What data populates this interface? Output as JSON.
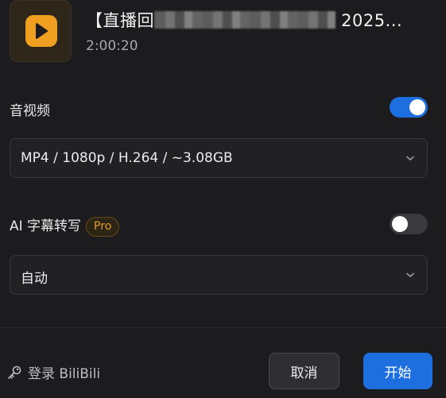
{
  "video": {
    "title_prefix": "【直播回",
    "title_suffix": " 2025...",
    "duration": "2:00:20"
  },
  "audio_video": {
    "label": "音视频",
    "enabled": true,
    "format_value": "MP4 / 1080p / H.264 / ~3.08GB"
  },
  "ai_subtitle": {
    "label": "AI 字幕转写",
    "badge": "Pro",
    "enabled": false,
    "language_value": "自动"
  },
  "footer": {
    "login_label": "登录 BiliBili",
    "cancel_label": "取消",
    "start_label": "开始"
  },
  "colors": {
    "accent": "#1d6fe0",
    "pro": "#e39a25",
    "logo": "#f0a020"
  }
}
